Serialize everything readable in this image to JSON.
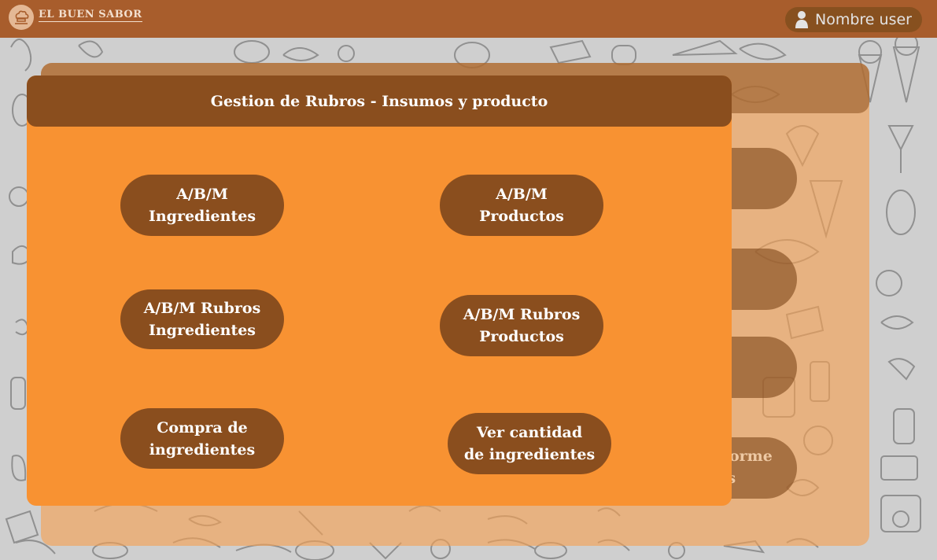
{
  "app": {
    "brand": "EL BUEN SABOR",
    "user_name": "Nombre user"
  },
  "panel": {
    "title": "Gestion de Rubros - Insumos y producto",
    "buttons": [
      {
        "label": "A/B/M\nIngredientes"
      },
      {
        "label": "A/B/M\nProductos"
      },
      {
        "label": "A/B/M Rubros\nIngredientes"
      },
      {
        "label": "A/B/M Rubros\nProductos"
      },
      {
        "label": "Compra de\ningredientes"
      },
      {
        "label": "Ver cantidad\nde ingredientes"
      }
    ]
  },
  "background_panel": {
    "partial_label": "nforme\nias"
  },
  "colors": {
    "topbar": "#a85d2c",
    "panel": "#f89232",
    "button": "#8a4e1e",
    "page_background": "#cfcfcf"
  },
  "icons": {
    "logo": "chef-hat-icon",
    "user": "user-icon"
  }
}
